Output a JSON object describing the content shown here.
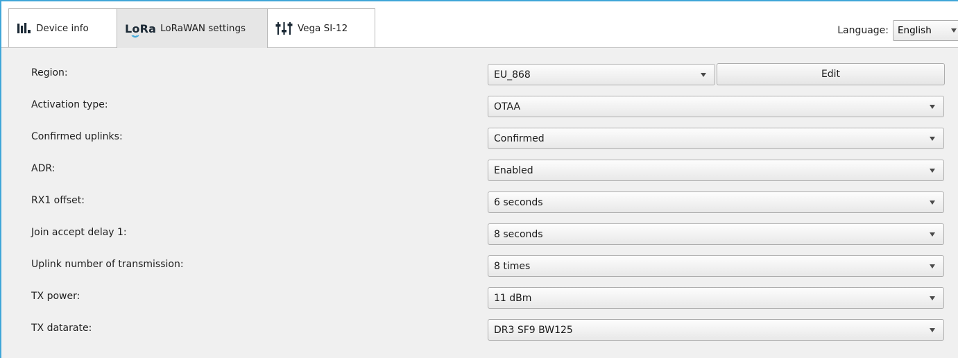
{
  "tabs": [
    {
      "label": "Device info",
      "icon": "bar-chart-icon",
      "active": false
    },
    {
      "label": "LoRaWAN settings",
      "icon_text": "LoRa",
      "active": true
    },
    {
      "label": "Vega SI-12",
      "icon": "sliders-icon",
      "active": false
    }
  ],
  "language": {
    "label": "Language:",
    "value": "English"
  },
  "settings": {
    "region": {
      "label": "Region:",
      "value": "EU_868",
      "edit_label": "Edit"
    },
    "activation_type": {
      "label": "Activation type:",
      "value": "OTAA"
    },
    "confirmed_uplinks": {
      "label": "Confirmed uplinks:",
      "value": "Confirmed"
    },
    "adr": {
      "label": "ADR:",
      "value": "Enabled"
    },
    "rx1_offset": {
      "label": "RX1 offset:",
      "value": "6 seconds"
    },
    "join_accept_delay_1": {
      "label": "Join accept delay 1:",
      "value": "8 seconds"
    },
    "uplink_number_of_transmission": {
      "label": "Uplink number of transmission:",
      "value": "8 times"
    },
    "tx_power": {
      "label": "TX power:",
      "value": "11 dBm"
    },
    "tx_datarate": {
      "label": "TX datarate:",
      "value": "DR3 SF9 BW125"
    }
  },
  "colors": {
    "window_border": "#3fa6d8",
    "content_bg": "#f0f0f0",
    "active_tab_bg": "#e6e6e6"
  }
}
